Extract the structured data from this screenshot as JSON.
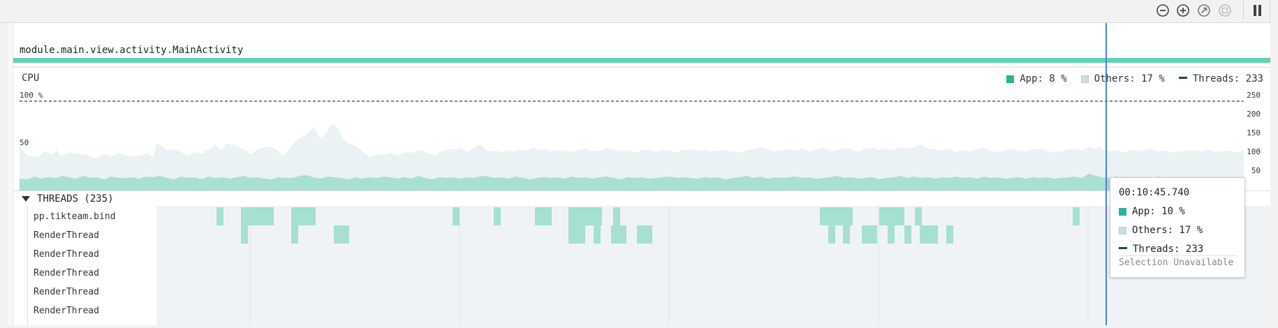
{
  "toolbar": {
    "icons": [
      "zoom-out-icon",
      "zoom-in-icon",
      "reset-zoom-icon",
      "select-range-icon",
      "pause-icon"
    ]
  },
  "activity": {
    "label": "module.main.view.activity.MainActivity"
  },
  "cpu": {
    "title": "CPU",
    "legend": {
      "app": "App: 8 %",
      "others": "Others: 17 %",
      "threads": "Threads: 233"
    },
    "left_axis": [
      "100 %",
      "50"
    ],
    "right_axis": [
      "250",
      "200",
      "150",
      "100",
      "50"
    ],
    "colors": {
      "app": "#2bb39a",
      "others": "#c9dde3",
      "threads": "#1e4a40"
    }
  },
  "threads": {
    "title": "THREADS (235)",
    "names": [
      "pp.tikteam.bind",
      "RenderThread",
      "RenderThread",
      "RenderThread",
      "RenderThread",
      "RenderThread"
    ]
  },
  "tooltip": {
    "time": "00:10:45.740",
    "app": "App: 10 %",
    "others": "Others: 17 %",
    "threads": "Threads: 233",
    "selection": "Selection Unavailable"
  }
}
